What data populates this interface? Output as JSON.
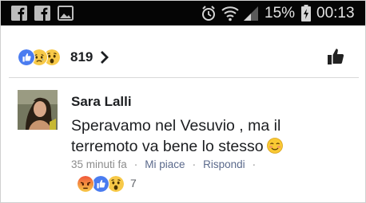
{
  "status_bar": {
    "battery": "15%",
    "time": "00:13",
    "icons": [
      "facebook-icon",
      "facebook-icon",
      "gallery-icon",
      "alarm-icon",
      "wifi-icon",
      "signal-icon",
      "battery-charging-icon"
    ]
  },
  "post": {
    "reactions": {
      "icons": [
        "like-reaction-icon",
        "sad-reaction-icon",
        "wow-reaction-icon"
      ],
      "count": "819"
    }
  },
  "comment": {
    "author": "Sara Lalli",
    "text": "Speravamo nel Vesuvio , ma il terremoto va bene lo stesso",
    "emoji": "blush-smiley-icon",
    "time": "35 minuti fa",
    "like_label": "Mi piace",
    "reply_label": "Rispondi",
    "reactions": {
      "icons": [
        "angry-reaction-icon",
        "like-reaction-icon",
        "wow-reaction-icon"
      ],
      "count": "7"
    }
  },
  "colors": {
    "status_bar": "#050505",
    "like_blue": "#4a7cf0",
    "reaction_yellow": "#f7c948",
    "angry_red": "#f0563a",
    "text": "#1c1e21",
    "meta_gray": "#8c8c8c"
  }
}
